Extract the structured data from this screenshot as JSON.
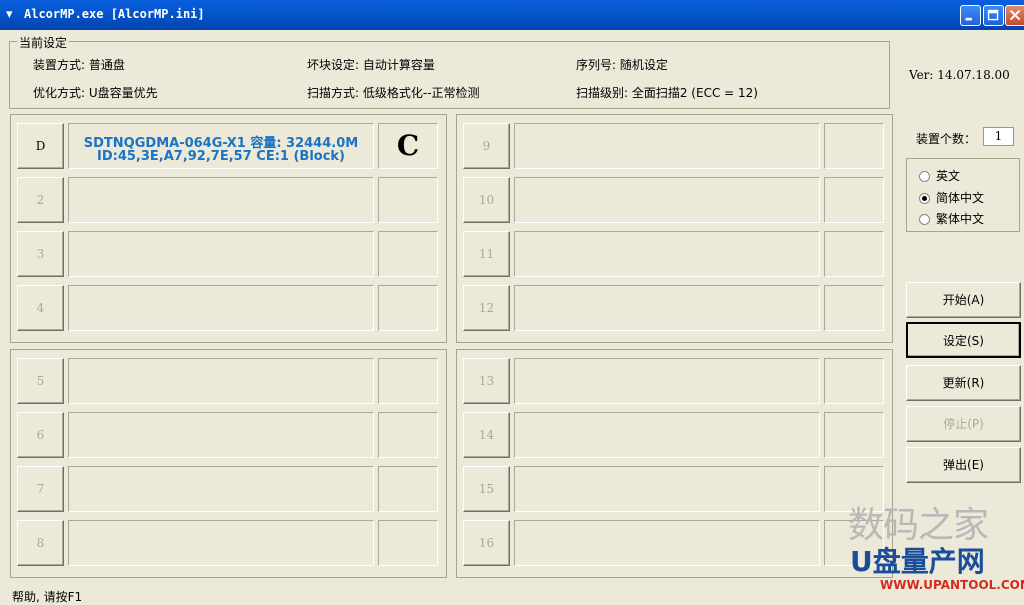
{
  "window": {
    "title": "AlcorMP.exe [AlcorMP.ini]",
    "icon": "tool-icon"
  },
  "settings": {
    "legend": "当前设定",
    "mount_mode": "装置方式: 普通盘",
    "optimize_mode": "优化方式: U盘容量优先",
    "bad_block": "坏块设定: 自动计算容量",
    "scan_mode": "扫描方式: 低级格式化--正常检测",
    "serial": "序列号: 随机设定",
    "scan_level": "扫描级别: 全面扫描2 (ECC = 12)"
  },
  "version": "Ver: 14.07.18.00",
  "device_count": {
    "label": "装置个数：",
    "value": "1"
  },
  "language": {
    "options": [
      "英文",
      "简体中文",
      "繁体中文"
    ],
    "selected": "简体中文"
  },
  "actions": {
    "start": "开始(A)",
    "settings": "设定(S)",
    "refresh": "更新(R)",
    "stop": "停止(P)",
    "eject": "弹出(E)"
  },
  "slots": [
    {
      "label": "D",
      "line1": "SDTNQGDMA-064G-X1 容量: 32444.0M",
      "line2": "ID:45,3E,A7,92,7E,57 CE:1 (Block)",
      "status": "C"
    },
    {
      "label": "2",
      "line1": "",
      "line2": "",
      "status": ""
    },
    {
      "label": "3",
      "line1": "",
      "line2": "",
      "status": ""
    },
    {
      "label": "4",
      "line1": "",
      "line2": "",
      "status": ""
    },
    {
      "label": "5",
      "line1": "",
      "line2": "",
      "status": ""
    },
    {
      "label": "6",
      "line1": "",
      "line2": "",
      "status": ""
    },
    {
      "label": "7",
      "line1": "",
      "line2": "",
      "status": ""
    },
    {
      "label": "8",
      "line1": "",
      "line2": "",
      "status": ""
    },
    {
      "label": "9",
      "line1": "",
      "line2": "",
      "status": ""
    },
    {
      "label": "10",
      "line1": "",
      "line2": "",
      "status": ""
    },
    {
      "label": "11",
      "line1": "",
      "line2": "",
      "status": ""
    },
    {
      "label": "12",
      "line1": "",
      "line2": "",
      "status": ""
    },
    {
      "label": "13",
      "line1": "",
      "line2": "",
      "status": ""
    },
    {
      "label": "14",
      "line1": "",
      "line2": "",
      "status": ""
    },
    {
      "label": "15",
      "line1": "",
      "line2": "",
      "status": ""
    },
    {
      "label": "16",
      "line1": "",
      "line2": "",
      "status": ""
    }
  ],
  "status_bar": "帮助, 请按F1",
  "watermark": {
    "line1": "数码之家",
    "line2": "U盘量产网",
    "line3": "WWW.UPANTOOL.COM"
  }
}
